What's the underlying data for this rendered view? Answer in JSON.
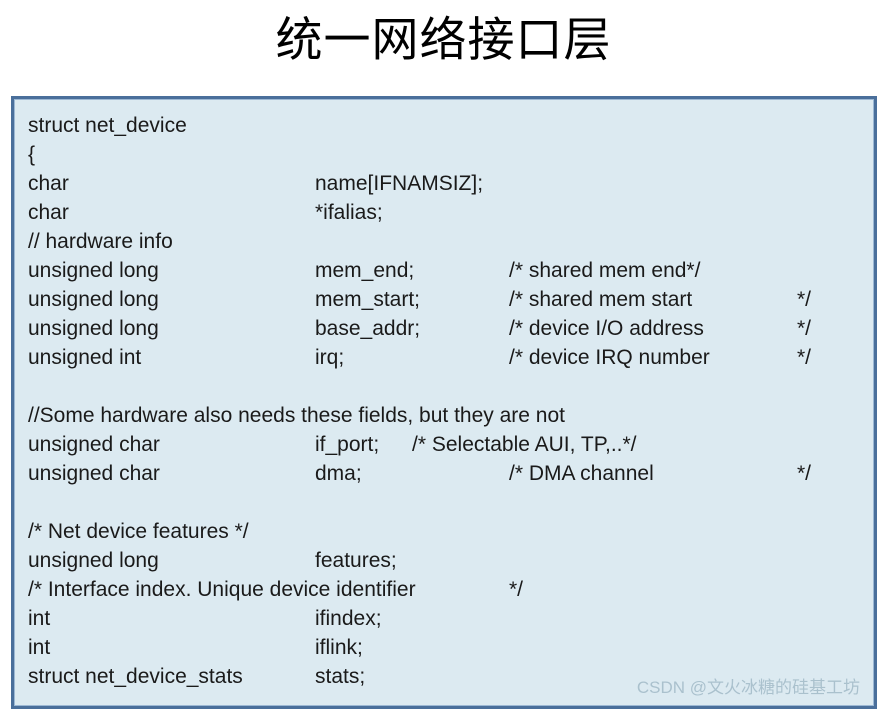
{
  "slide": {
    "title": "统一网络接口层"
  },
  "code_box": {
    "background_color": "#dceaf1",
    "border_color": "#4a6f9b",
    "lines": [
      {
        "type": "struct net_device",
        "name": "",
        "comment": "",
        "tail": ""
      },
      {
        "type": "{",
        "name": "",
        "comment": "",
        "tail": ""
      },
      {
        "type": "char",
        "name": "name[IFNAMSIZ];",
        "comment": "",
        "tail": ""
      },
      {
        "type": "char",
        "name": "*ifalias;",
        "comment": "",
        "tail": ""
      },
      {
        "type": "// hardware info",
        "name": "",
        "comment": "",
        "tail": ""
      },
      {
        "type": "unsigned long",
        "name": "mem_end;",
        "comment": "/* shared mem end*/",
        "tail": ""
      },
      {
        "type": "unsigned long",
        "name": "mem_start;",
        "comment": "/* shared mem start",
        "tail": "*/"
      },
      {
        "type": "unsigned long",
        "name": "base_addr;",
        "comment": "/* device I/O address",
        "tail": "*/"
      },
      {
        "type": "unsigned int",
        "name": "irq;",
        "comment": "/* device IRQ number",
        "tail": "*/"
      },
      {
        "type": "",
        "name": "",
        "comment": "",
        "tail": ""
      },
      {
        "type": "//Some hardware also needs these fields, but they are not",
        "name": "",
        "comment": "",
        "tail": ""
      },
      {
        "type": "unsigned char",
        "name": "if_port;",
        "comment": "/* Selectable AUI, TP,..*/",
        "tail": "",
        "comment_early": true
      },
      {
        "type": "unsigned char",
        "name": "dma;",
        "comment": "/* DMA channel",
        "tail": "*/"
      },
      {
        "type": "",
        "name": "",
        "comment": "",
        "tail": ""
      },
      {
        "type": "/* Net device features */",
        "name": "",
        "comment": "",
        "tail": ""
      },
      {
        "type": "unsigned long",
        "name": "features;",
        "comment": "",
        "tail": ""
      },
      {
        "type": "/* Interface index. Unique device identifier",
        "name": "",
        "comment": "*/",
        "tail": ""
      },
      {
        "type": "int",
        "name": "ifindex;",
        "comment": "",
        "tail": ""
      },
      {
        "type": "int",
        "name": "iflink;",
        "comment": "",
        "tail": ""
      },
      {
        "type": "struct net_device_stats",
        "name": "stats;",
        "comment": "",
        "tail": ""
      }
    ]
  },
  "watermark": {
    "text": "CSDN @文火冰糖的硅基工坊"
  }
}
